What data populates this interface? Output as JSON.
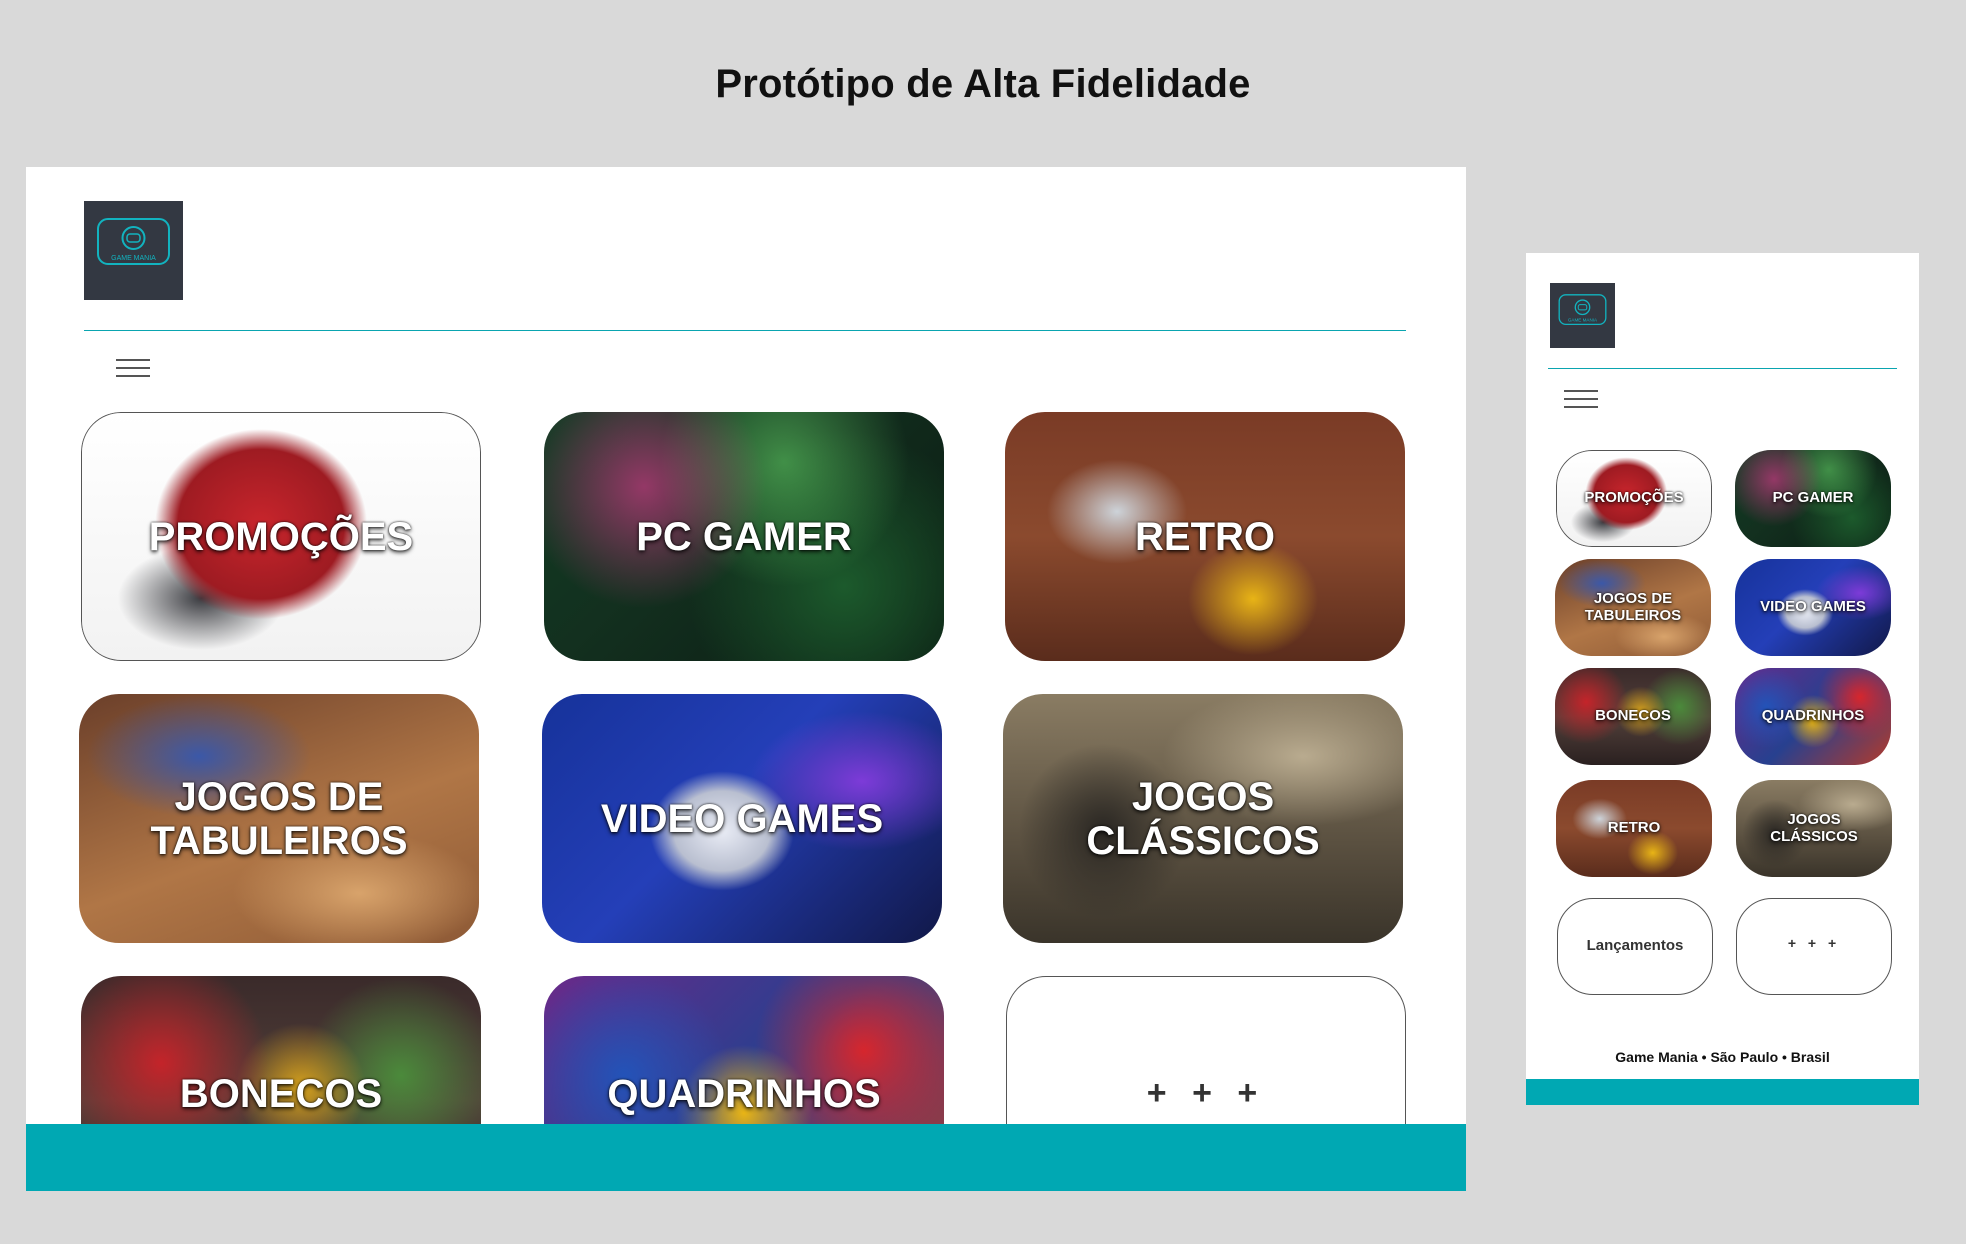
{
  "page": {
    "title": "Protótipo de Alta Fidelidade"
  },
  "brand": {
    "name": "GAME MANIA",
    "icon": "game-controller-icon",
    "accent": "#00a8b3",
    "logo_bg": "#333842"
  },
  "desktop": {
    "menu_icon": "hamburger-menu-icon",
    "tiles": [
      {
        "id": "promocoes",
        "label": "PROMOÇÕES",
        "style": "photo"
      },
      {
        "id": "pcgamer",
        "label": "PC GAMER",
        "style": "photo"
      },
      {
        "id": "retro",
        "label": "RETRO",
        "style": "photo"
      },
      {
        "id": "tabuleiros",
        "label": "JOGOS DE TABULEIROS",
        "style": "photo"
      },
      {
        "id": "videogames",
        "label": "VIDEO GAMES",
        "style": "photo"
      },
      {
        "id": "classicos",
        "label": "JOGOS CLÁSSICOS",
        "style": "photo"
      },
      {
        "id": "bonecos",
        "label": "BONECOS",
        "style": "photo"
      },
      {
        "id": "quadrinhos",
        "label": "QUADRINHOS",
        "style": "photo"
      },
      {
        "id": "mais",
        "label": "+ + +",
        "style": "outline"
      }
    ]
  },
  "mobile": {
    "menu_icon": "hamburger-menu-icon",
    "tiles": [
      {
        "id": "promocoes",
        "label": "PROMOÇÕES",
        "style": "photo"
      },
      {
        "id": "pcgamer",
        "label": "PC GAMER",
        "style": "photo"
      },
      {
        "id": "tabuleiros",
        "label": "JOGOS DE TABULEIROS",
        "style": "photo"
      },
      {
        "id": "videogames",
        "label": "VIDEO GAMES",
        "style": "photo"
      },
      {
        "id": "bonecos",
        "label": "BONECOS",
        "style": "photo"
      },
      {
        "id": "quadrinhos",
        "label": "QUADRINHOS",
        "style": "photo"
      },
      {
        "id": "retro",
        "label": "RETRO",
        "style": "photo"
      },
      {
        "id": "classicos",
        "label": "JOGOS CLÁSSICOS",
        "style": "photo"
      },
      {
        "id": "lancamentos",
        "label": "Lançamentos",
        "style": "outline"
      },
      {
        "id": "mais",
        "label": "+ + +",
        "style": "outline"
      }
    ],
    "footer": "Game Mania •  São Paulo • Brasil"
  }
}
